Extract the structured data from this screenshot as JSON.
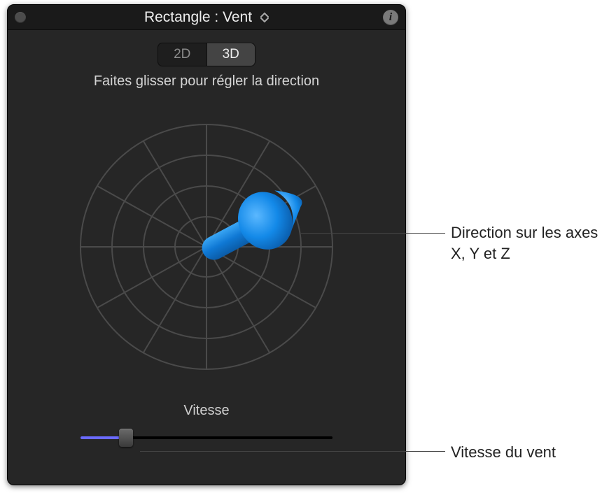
{
  "header": {
    "title": "Rectangle : Vent"
  },
  "mode": {
    "option_2d": "2D",
    "option_3d": "3D",
    "active": "3D"
  },
  "instruction": "Faites glisser pour régler la direction",
  "speed": {
    "label": "Vitesse",
    "value_percent": 18
  },
  "callouts": {
    "direction": "Direction sur les axes X, Y et Z",
    "speed": "Vitesse du vent"
  },
  "colors": {
    "arrow": "#0a84ff",
    "slider_fill": "#6a6aff"
  }
}
